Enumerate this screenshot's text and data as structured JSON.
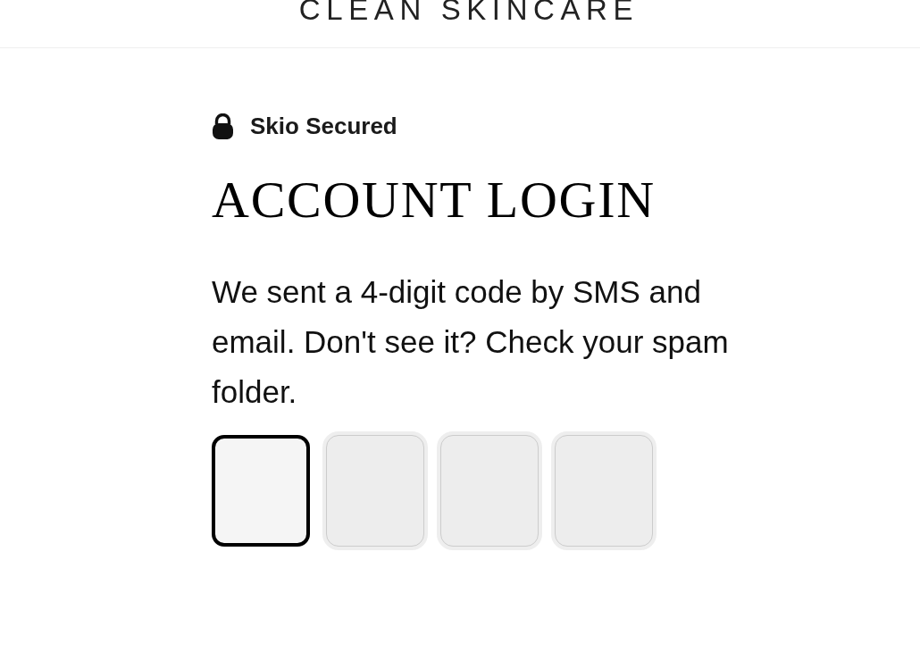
{
  "header": {
    "logo": "CLEAN SKINCARE"
  },
  "security_badge": {
    "label": "Skio Secured"
  },
  "title": "ACCOUNT LOGIN",
  "message": "We sent a 4-digit code by SMS and email. Don't see it? Check your spam folder.",
  "code_inputs": [
    {
      "focused": true
    },
    {
      "focused": false
    },
    {
      "focused": false
    },
    {
      "focused": false
    }
  ]
}
